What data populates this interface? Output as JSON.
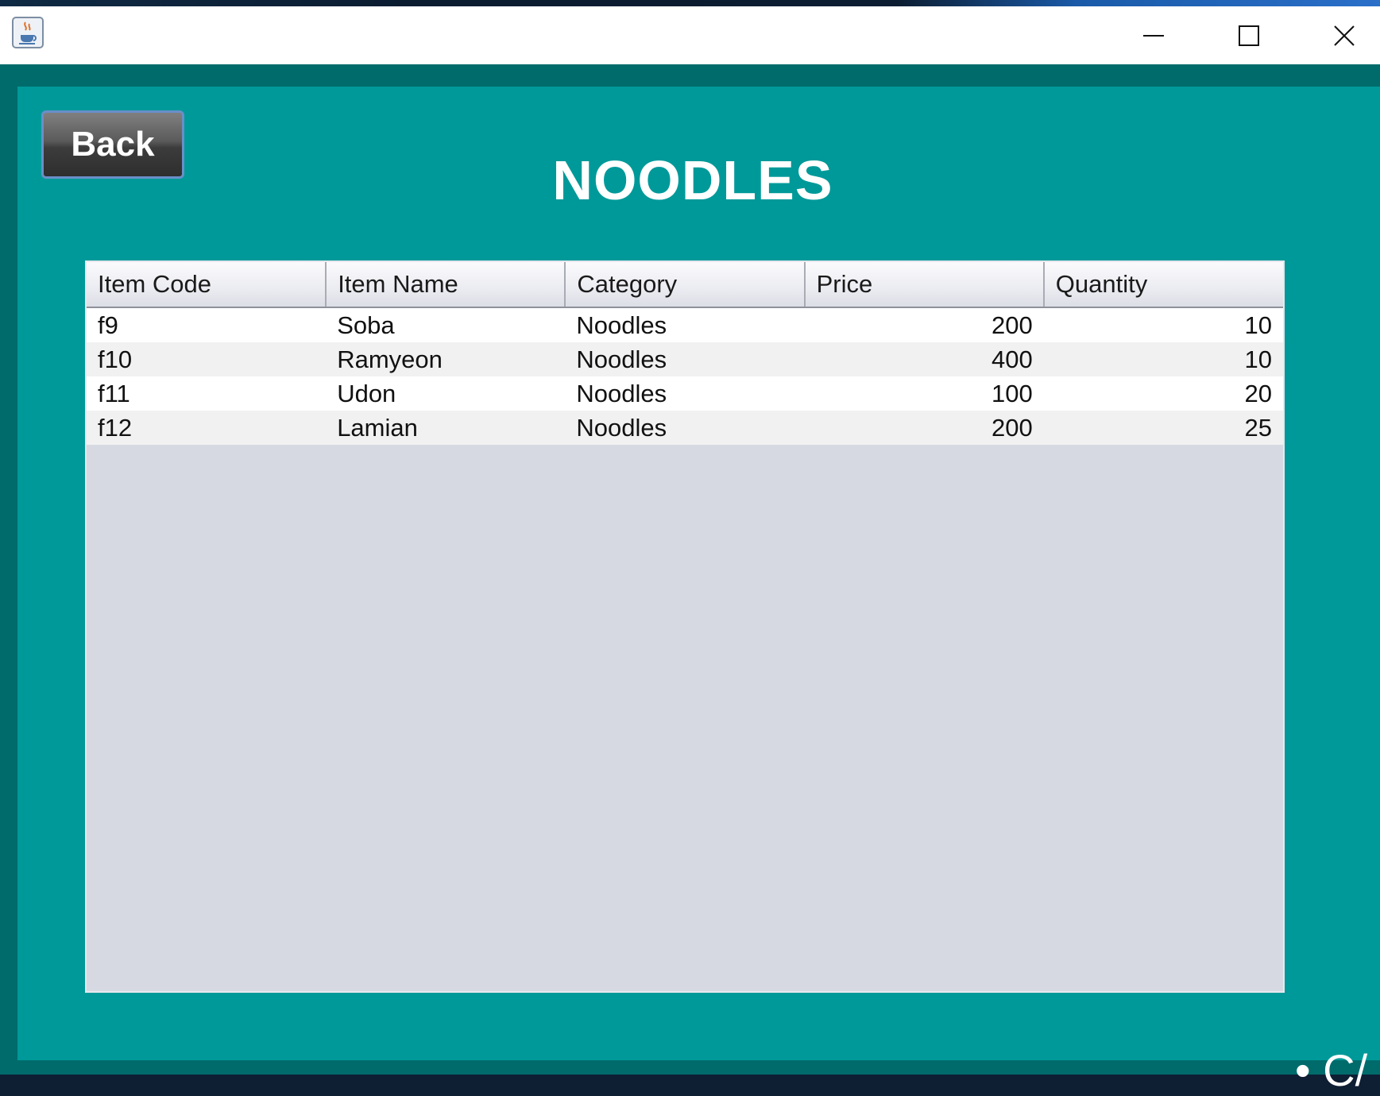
{
  "window": {
    "minimize_icon": "minimize-icon",
    "maximize_icon": "maximize-icon",
    "close_icon": "close-icon",
    "app_icon": "java-coffee-cup-icon"
  },
  "back_button": {
    "label": "Back"
  },
  "page_title": "NOODLES",
  "table": {
    "columns": [
      "Item Code",
      "Item Name",
      "Category",
      "Price",
      "Quantity"
    ],
    "rows": [
      {
        "code": "f9",
        "name": "Soba",
        "category": "Noodles",
        "price": "200",
        "quantity": "10"
      },
      {
        "code": "f10",
        "name": "Ramyeon",
        "category": "Noodles",
        "price": "400",
        "quantity": "10"
      },
      {
        "code": "f11",
        "name": "Udon",
        "category": "Noodles",
        "price": "100",
        "quantity": "20"
      },
      {
        "code": "f12",
        "name": "Lamian",
        "category": "Noodles",
        "price": "200",
        "quantity": "25"
      }
    ]
  },
  "corner_text": "• C/",
  "colors": {
    "frame": "#006b6b",
    "panel": "#009999",
    "table_empty_area": "#d6d9e1",
    "title_text": "#ffffff"
  }
}
